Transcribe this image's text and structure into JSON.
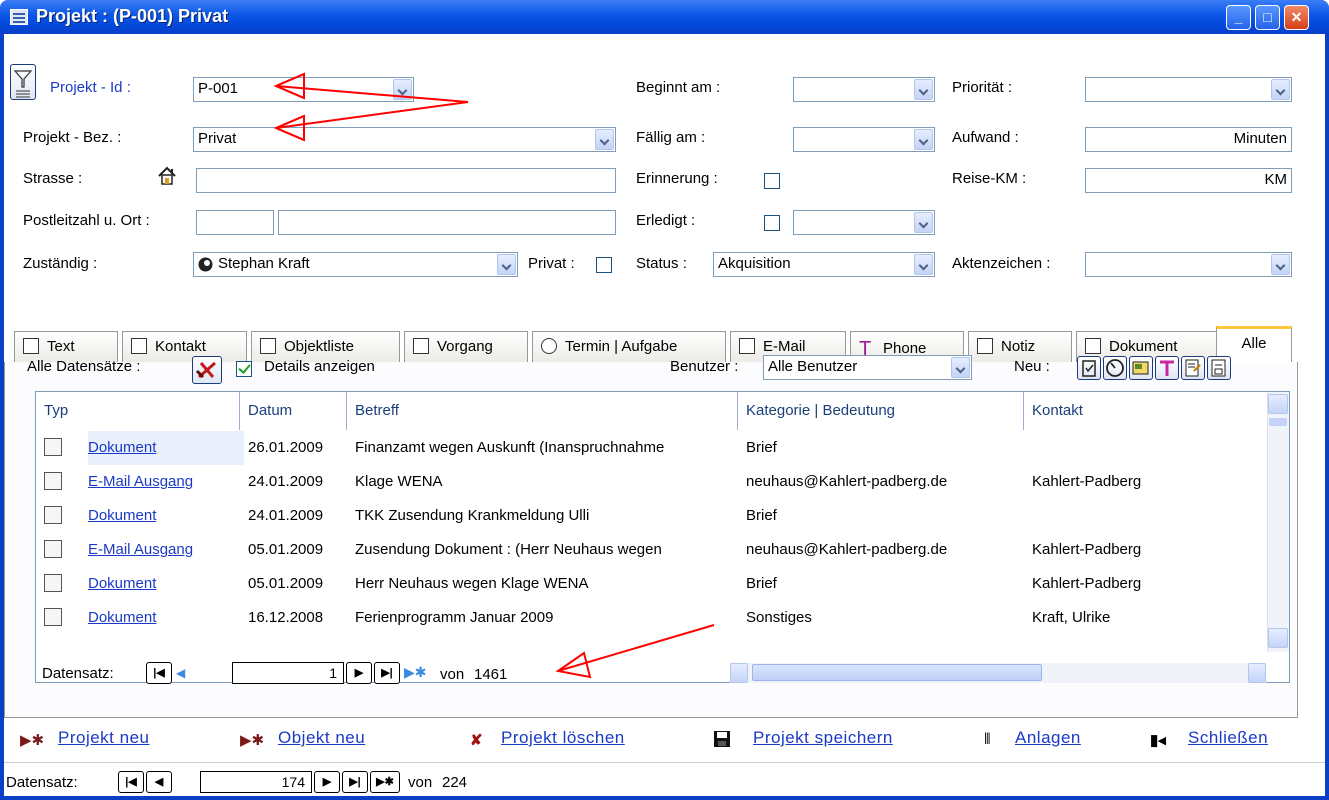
{
  "window": {
    "title": "Projekt : (P-001) Privat"
  },
  "titlebar_buttons": [
    "_",
    "□",
    "✕"
  ],
  "form": {
    "projekt_id": {
      "label": "Projekt - Id :",
      "value": "P-001"
    },
    "projekt_bez": {
      "label": "Projekt - Bez. :",
      "value": "Privat"
    },
    "strasse": {
      "label": "Strasse :",
      "value": ""
    },
    "plz_ort": {
      "label": "Postleitzahl u. Ort :",
      "plz": "",
      "ort": ""
    },
    "zustaendig": {
      "label": "Zuständig :",
      "value": "Stephan Kraft"
    },
    "privat": {
      "label": "Privat :",
      "checked": false
    },
    "beginnt_am": {
      "label": "Beginnt am :",
      "value": ""
    },
    "faellig_am": {
      "label": "Fällig am :",
      "value": ""
    },
    "erinnerung": {
      "label": "Erinnerung :",
      "checked": false
    },
    "erledigt": {
      "label": "Erledigt :",
      "checked": false,
      "value": ""
    },
    "status": {
      "label": "Status :",
      "value": "Akquisition"
    },
    "prioritaet": {
      "label": "Priorität :",
      "value": ""
    },
    "aufwand": {
      "label": "Aufwand :",
      "value": "Minuten"
    },
    "reise_km": {
      "label": "Reise-KM :",
      "value": "KM"
    },
    "aktenzeichen": {
      "label": "Aktenzeichen :",
      "value": ""
    }
  },
  "tabs": [
    {
      "label": "Text",
      "icon": "page-icon"
    },
    {
      "label": "Kontakt",
      "icon": "contact-card-icon"
    },
    {
      "label": "Objektliste",
      "icon": "object-list-icon"
    },
    {
      "label": "Vorgang",
      "icon": "process-icon"
    },
    {
      "label": "Termin | Aufgabe",
      "icon": "clock-icon"
    },
    {
      "label": "E-Mail",
      "icon": "email-icon"
    },
    {
      "label": "Phone",
      "icon": "phone-t-icon"
    },
    {
      "label": "Notiz",
      "icon": "note-icon"
    },
    {
      "label": "Dokument",
      "icon": "document-icon"
    },
    {
      "label": "Alle",
      "icon": ""
    }
  ],
  "panel": {
    "alle_label": "Alle Datensätze :",
    "details_label": "Details anzeigen",
    "details_checked": true,
    "benutzer_label": "Benutzer :",
    "benutzer_value": "Alle Benutzer",
    "neu_label": "Neu :"
  },
  "grid": {
    "columns": [
      "Typ",
      "Datum",
      "Betreff",
      "Kategorie  |  Bedeutung",
      "Kontakt"
    ],
    "rows": [
      {
        "typ": "Dokument",
        "icon": "document-icon",
        "datum": "26.01.2009",
        "betreff": "Finanzamt wegen Auskunft (Inanspruchnahme",
        "kategorie": "Brief",
        "kontakt": ""
      },
      {
        "typ": "E-Mail Ausgang",
        "icon": "email-out-icon",
        "datum": "24.01.2009",
        "betreff": "Klage WENA",
        "kategorie": "neuhaus@Kahlert-padberg.de",
        "kontakt": "Kahlert-Padberg"
      },
      {
        "typ": "Dokument",
        "icon": "document-icon",
        "datum": "24.01.2009",
        "betreff": "TKK Zusendung Krankmeldung Ulli",
        "kategorie": "Brief",
        "kontakt": ""
      },
      {
        "typ": "E-Mail Ausgang",
        "icon": "email-out-icon",
        "datum": "05.01.2009",
        "betreff": "Zusendung Dokument : (Herr Neuhaus wegen",
        "kategorie": "neuhaus@Kahlert-padberg.de",
        "kontakt": "Kahlert-Padberg"
      },
      {
        "typ": "Dokument",
        "icon": "document-icon",
        "datum": "05.01.2009",
        "betreff": "Herr Neuhaus wegen Klage WENA",
        "kategorie": "Brief",
        "kontakt": "Kahlert-Padberg"
      },
      {
        "typ": "Dokument",
        "icon": "document-icon",
        "datum": "16.12.2008",
        "betreff": "Ferienprogramm Januar 2009",
        "kategorie": "Sonstiges",
        "kontakt": "Kraft, Ulrike"
      }
    ]
  },
  "subnav": {
    "label": "Datensatz:",
    "current": "1",
    "total_label": "von",
    "total": "1461"
  },
  "commands": {
    "projekt_neu": "Projekt neu",
    "objekt_neu": "Objekt neu",
    "projekt_loeschen": "Projekt löschen",
    "projekt_speichern": "Projekt speichern",
    "anlagen": "Anlagen",
    "schliessen": "Schließen"
  },
  "mainnav": {
    "label": "Datensatz:",
    "current": "174",
    "total_label": "von",
    "total": "224"
  },
  "colors": {
    "titlebar": "#0a56e6",
    "link": "#1a3ac6",
    "header_text": "#1a3f7a",
    "annotation_arrow": "#ff0000"
  }
}
